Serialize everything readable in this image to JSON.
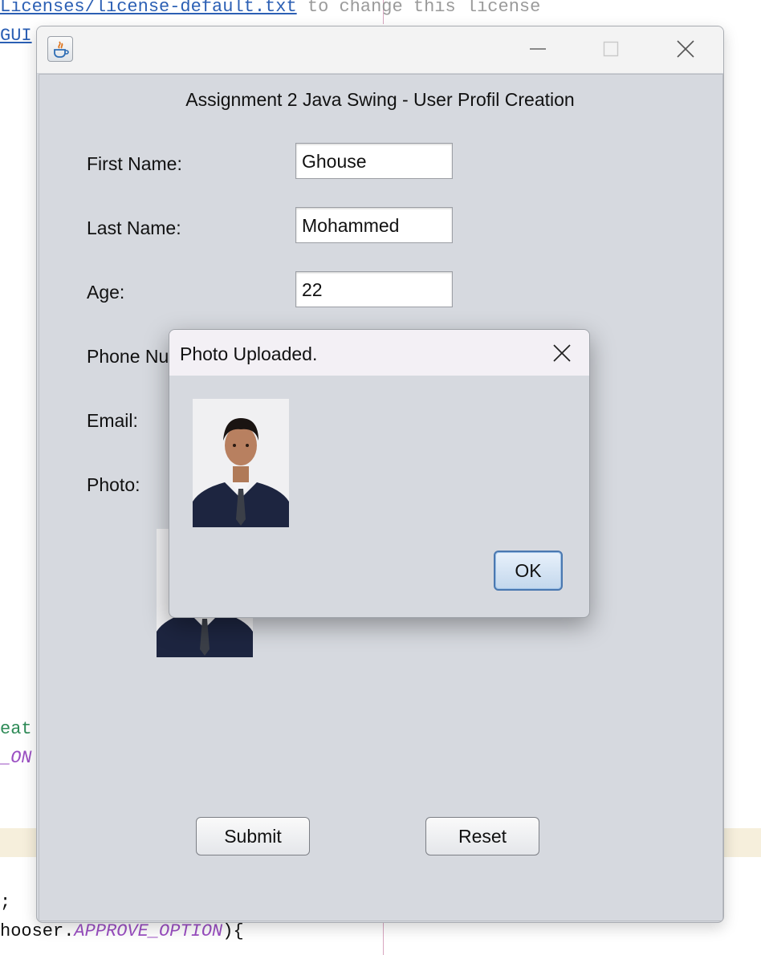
{
  "editor": {
    "line1_link": "Licenses/license-default.txt",
    "line1_comment": " to change this license",
    "line2_link": "GUI",
    "frag_eat": "eat",
    "frag_on": "_ON",
    "frag_semicolon": ";",
    "frag_hooser": "hooser.",
    "frag_approve": "APPROVE_OPTION",
    "frag_brace": "){"
  },
  "window": {
    "icon": "java-cup-icon",
    "minimize_icon": "minimize-icon",
    "maximize_icon": "maximize-icon",
    "close_icon": "close-icon"
  },
  "form": {
    "heading": "Assignment 2 Java Swing - User Profil Creation",
    "first_name_label": "First Name:",
    "first_name_value": "Ghouse",
    "last_name_label": "Last Name:",
    "last_name_value": "Mohammed",
    "age_label": "Age:",
    "age_value": "22",
    "phone_label": "Phone Nu",
    "email_label": "Email:",
    "photo_label": "Photo:",
    "submit_label": "Submit",
    "reset_label": "Reset"
  },
  "dialog": {
    "title": "Photo Uploaded.",
    "close_icon": "close-icon",
    "ok_label": "OK"
  },
  "colors": {
    "frame_bg": "#d6d9df",
    "link": "#2b5fb4",
    "suit": "#1d2540",
    "ok_border": "#4a78b0"
  }
}
